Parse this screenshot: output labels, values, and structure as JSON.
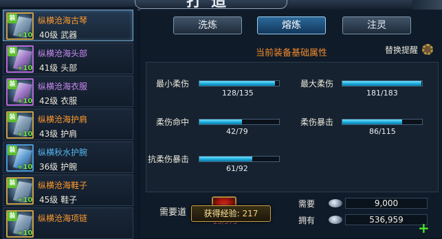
{
  "header": {
    "title": "打造"
  },
  "equipment_list": [
    {
      "name": "纵横沧海古琴",
      "level": "40级 武器",
      "badge": "装",
      "enhance": "+10",
      "quality": "orange",
      "selected": true
    },
    {
      "name": "纵横沧海头部",
      "level": "41级 头部",
      "badge": "装",
      "enhance": "+10",
      "quality": "purple",
      "selected": false
    },
    {
      "name": "纵横沧海衣服",
      "level": "42级 衣服",
      "badge": "装",
      "enhance": "+10",
      "quality": "purple",
      "selected": false
    },
    {
      "name": "纵横沧海护肩",
      "level": "43级 护肩",
      "badge": "装",
      "enhance": "+10",
      "quality": "orange",
      "selected": false
    },
    {
      "name": "纵横秋水护腕",
      "level": "36级 护腕",
      "badge": "装",
      "enhance": "+10",
      "quality": "blue",
      "selected": false
    },
    {
      "name": "纵横沧海鞋子",
      "level": "45级 鞋子",
      "badge": "装",
      "enhance": "+10",
      "quality": "orange",
      "selected": false
    },
    {
      "name": "纵横沧海项链",
      "level": "",
      "badge": "装",
      "enhance": "+10",
      "quality": "orange",
      "selected": false
    }
  ],
  "tabs": [
    {
      "label": "洗炼",
      "active": false
    },
    {
      "label": "熔炼",
      "active": true
    },
    {
      "label": "注灵",
      "active": false
    }
  ],
  "section": {
    "title": "当前装备基础属性",
    "hint": "替换提醒"
  },
  "stats": [
    {
      "label": "最小柔伤",
      "value": "128/135",
      "ratio": 0.948
    },
    {
      "label": "最大柔伤",
      "value": "181/183",
      "ratio": 0.989
    },
    {
      "label": "柔伤命中",
      "value": "42/79",
      "ratio": 0.532
    },
    {
      "label": "柔伤暴击",
      "value": "86/115",
      "ratio": 0.748
    },
    {
      "label": "抗柔伤暴击",
      "value": "61/92",
      "ratio": 0.663
    }
  ],
  "bottom": {
    "need_label": "需要道",
    "material_count": "25/575",
    "exp_label": "获得经验:",
    "exp_value": "217",
    "require_label": "需要",
    "require_value": "9,000",
    "own_label": "拥有",
    "own_value": "536,959",
    "add_symbol": "+"
  },
  "colors": {
    "orange_quality": "#ff9a2e",
    "purple_quality": "#c98af2",
    "blue_quality": "#54b7f2",
    "bar_fill": "#1aa6d6",
    "accent_title": "#f08a2c"
  }
}
